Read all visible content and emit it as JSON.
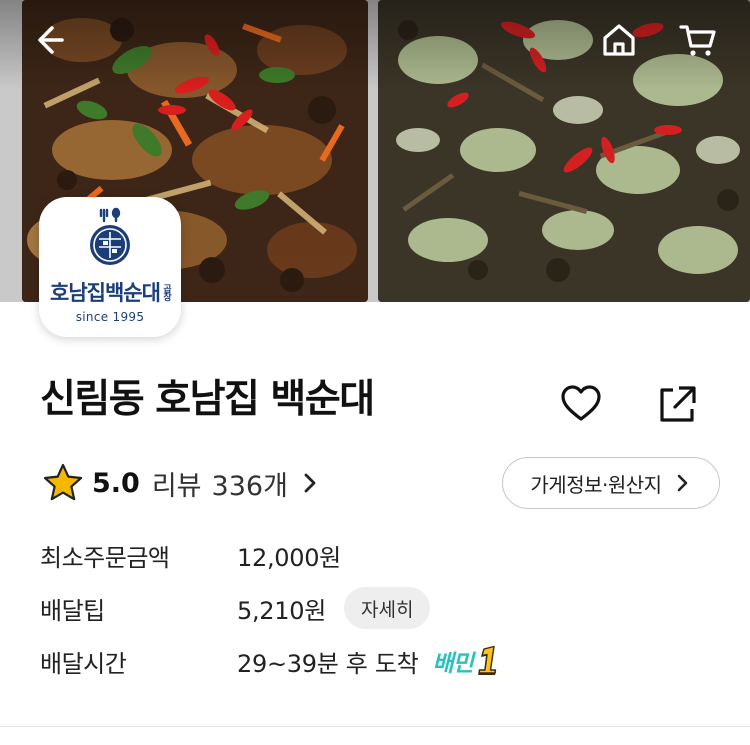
{
  "header": {
    "back_icon": "arrow-left-icon",
    "home_icon": "home-icon",
    "cart_icon": "cart-icon"
  },
  "logo": {
    "name": "호남집백순대",
    "sub": "곱창",
    "since": "since 1995",
    "brand_color": "#1c3e78"
  },
  "store": {
    "title": "신림동 호남집 백순대",
    "favorite_icon": "heart-outline-icon",
    "share_icon": "share-icon"
  },
  "rating": {
    "score": "5.0",
    "review_label": "리뷰",
    "review_count": "336개",
    "star_color": "#f5b800"
  },
  "info_button": {
    "label": "가게정보·원산지"
  },
  "info": {
    "min_order": {
      "label": "최소주문금액",
      "value": "12,000원"
    },
    "delivery_tip": {
      "label": "배달팁",
      "value": "5,210원",
      "detail_label": "자세히"
    },
    "delivery_time": {
      "label": "배달시간",
      "value": "29~39분 후 도착",
      "badge_text": "배민",
      "badge_number": "1"
    }
  },
  "accent": "#2ac1bc"
}
